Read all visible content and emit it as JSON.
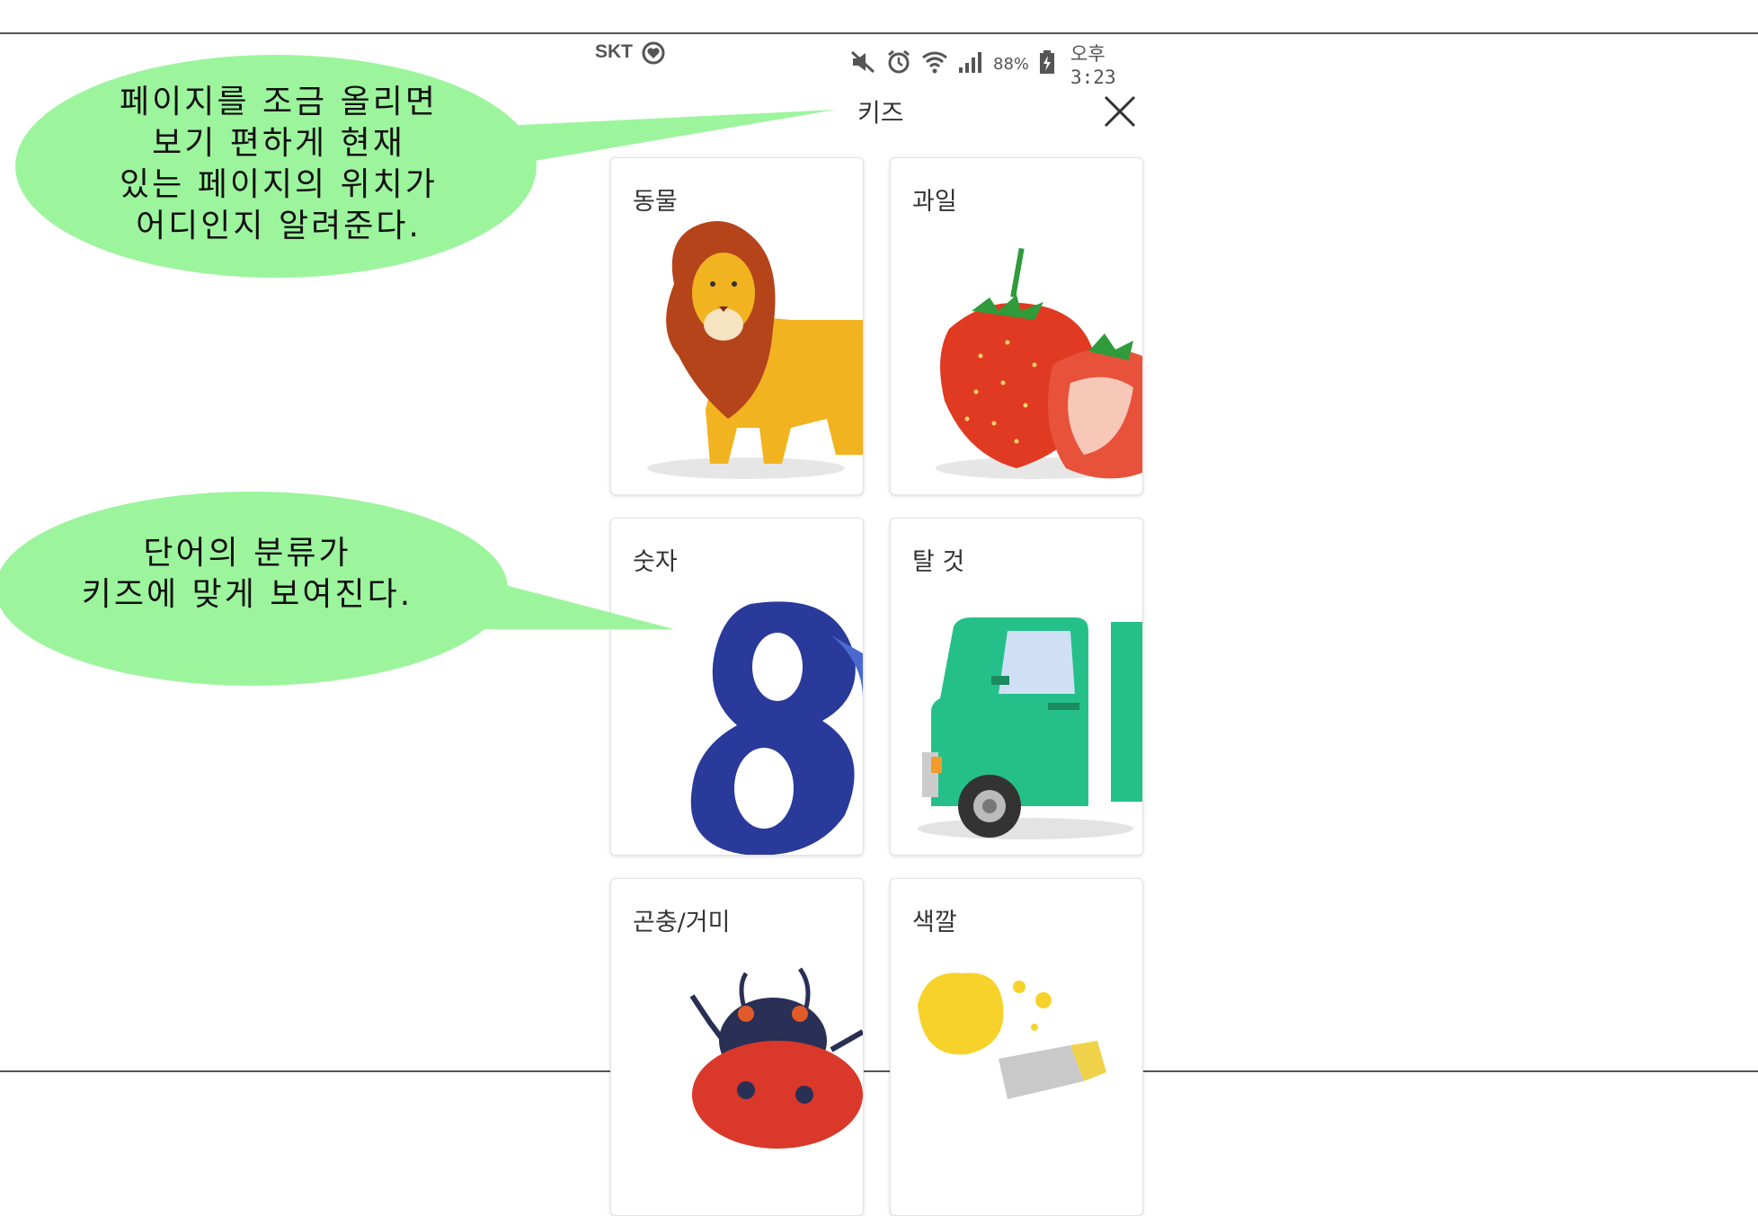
{
  "status_bar": {
    "carrier": "SKT",
    "battery": "88%",
    "time": "오후 3:23"
  },
  "header": {
    "title": "키즈",
    "close_icon": "close-icon"
  },
  "categories": [
    {
      "label": "동물",
      "icon": "lion-illustration"
    },
    {
      "label": "과일",
      "icon": "strawberry-illustration"
    },
    {
      "label": "숫자",
      "icon": "number-eight-illustration"
    },
    {
      "label": "탈 것",
      "icon": "truck-illustration"
    },
    {
      "label": "곤충/거미",
      "icon": "ladybug-illustration"
    },
    {
      "label": "색깔",
      "icon": "paint-tube-illustration"
    }
  ],
  "annotations": {
    "top": "페이지를 조금 올리면\n보기 편하게 현재\n있는 페이지의 위치가\n어디인지 알려준다.",
    "bottom": "단어의 분류가\n키즈에 맞게 보여진다."
  },
  "colors": {
    "callout": "#9cf59c",
    "lion": "#f2b320",
    "mane": "#b5441b",
    "strawberry": "#e03a22",
    "number": "#2a3a9a",
    "truck": "#25c08a",
    "ladybug": "#d9382a",
    "paint": "#f7d22a"
  }
}
